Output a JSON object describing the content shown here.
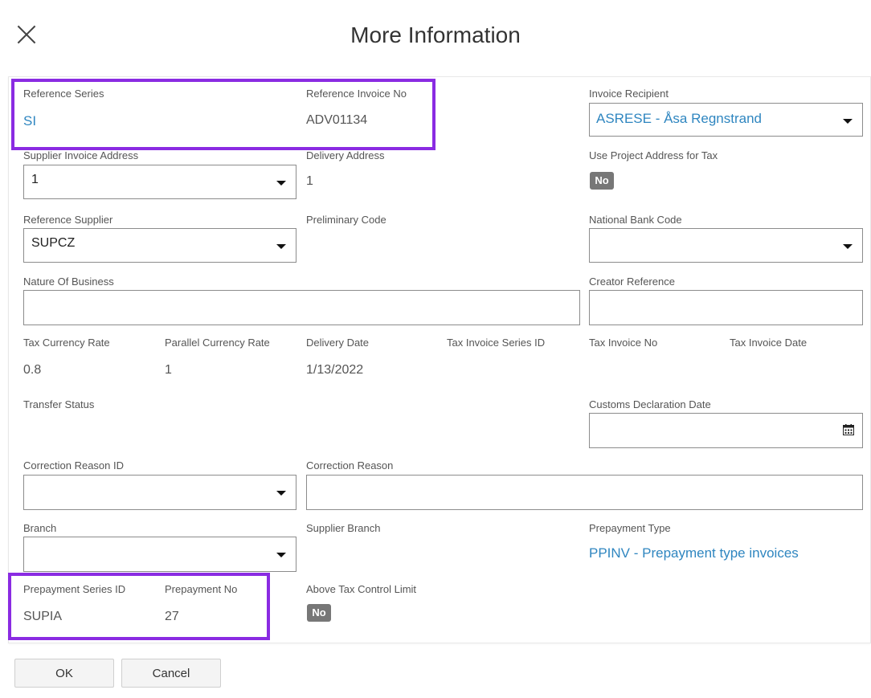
{
  "dialog": {
    "title": "More Information"
  },
  "fields": {
    "reference_series": {
      "label": "Reference Series",
      "value": "SI"
    },
    "reference_invoice_no": {
      "label": "Reference Invoice No",
      "value": "ADV01134"
    },
    "invoice_recipient": {
      "label": "Invoice Recipient",
      "value": "ASRESE - Åsa Regnstrand"
    },
    "supplier_invoice_address": {
      "label": "Supplier Invoice Address",
      "value": "1"
    },
    "delivery_address": {
      "label": "Delivery Address",
      "value": "1"
    },
    "use_project_address_for_tax": {
      "label": "Use Project Address for Tax",
      "value": "No"
    },
    "reference_supplier": {
      "label": "Reference Supplier",
      "value": "SUPCZ"
    },
    "preliminary_code": {
      "label": "Preliminary Code"
    },
    "national_bank_code": {
      "label": "National Bank Code",
      "value": ""
    },
    "nature_of_business": {
      "label": "Nature Of Business",
      "value": ""
    },
    "creator_reference": {
      "label": "Creator Reference",
      "value": ""
    },
    "tax_currency_rate": {
      "label": "Tax Currency Rate",
      "value": "0.8"
    },
    "parallel_currency_rate": {
      "label": "Parallel Currency Rate",
      "value": "1"
    },
    "delivery_date": {
      "label": "Delivery Date",
      "value": "1/13/2022"
    },
    "tax_invoice_series_id": {
      "label": "Tax Invoice Series ID"
    },
    "tax_invoice_no": {
      "label": "Tax Invoice No"
    },
    "tax_invoice_date": {
      "label": "Tax Invoice Date"
    },
    "transfer_status": {
      "label": "Transfer Status"
    },
    "customs_declaration_date": {
      "label": "Customs Declaration Date",
      "value": ""
    },
    "correction_reason_id": {
      "label": "Correction Reason ID",
      "value": ""
    },
    "correction_reason": {
      "label": "Correction Reason",
      "value": ""
    },
    "branch": {
      "label": "Branch",
      "value": ""
    },
    "supplier_branch": {
      "label": "Supplier Branch"
    },
    "prepayment_type": {
      "label": "Prepayment Type",
      "value": "PPINV - Prepayment type invoices"
    },
    "prepayment_series_id": {
      "label": "Prepayment Series ID",
      "value": "SUPIA"
    },
    "prepayment_no": {
      "label": "Prepayment No",
      "value": "27"
    },
    "above_tax_control_limit": {
      "label": "Above Tax Control Limit",
      "value": "No"
    }
  },
  "buttons": {
    "ok": "OK",
    "cancel": "Cancel"
  },
  "colors": {
    "highlight": "#8a2be2",
    "link": "#2f86c0",
    "badge": "#777777"
  },
  "icons": {
    "close": "close-icon",
    "calendar": "calendar-icon",
    "dropdown": "chevron-down-icon"
  }
}
